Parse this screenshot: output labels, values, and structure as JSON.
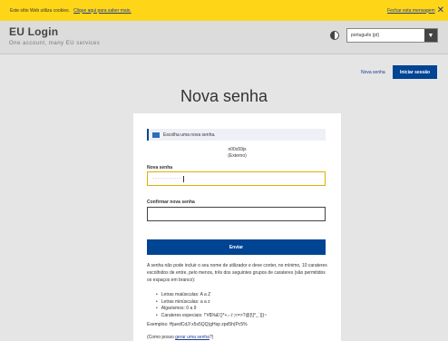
{
  "cookie_bar": {
    "message": "Este sítio Web utiliza cookies.",
    "link": "Clique aqui para saber mais.",
    "close_link": "Fechar esta mensagem",
    "close_icon": "close-icon"
  },
  "header": {
    "logo_title": "EU Login",
    "logo_subtitle": "One account, many EU services",
    "contrast_icon": "contrast-icon",
    "language_selected": "português (pt)",
    "language_arrow": "chevron-down-icon"
  },
  "top_links": {
    "new_password": "Nova senha",
    "login": "Iniciar sessão"
  },
  "main": {
    "title": "Nova senha",
    "info_message": "Escolha uma nova senha.",
    "user_id": "n00s59js",
    "user_type": "(Externo)",
    "password_label": "Nova senha",
    "password_value": "···········",
    "confirm_label": "Confirmar nova senha",
    "confirm_value": "",
    "submit_label": "Enviar",
    "rules_text": "A senha não pode incluir o seu nome de utilizador e deve conter, no mínimo, 10 carateres escolhidos de entre, pelo menos, três dos seguintes grupos de carateres (são permitidos os espaços em branco):",
    "rules": [
      "Letras maiúsculas: A a Z",
      "Letras minúsculas: a a z",
      "Algarismos: 0 a 9",
      "Carateres especiais: !\"#$%&'()*+,-./:;<=>?@[\\]^_`{|}~"
    ],
    "examples": "Exemplos: HjuedCdJl x5s5QQ)gHsp zpd5h(Pc5%",
    "more_prefix": "(Como posso ",
    "more_link": "gerar uma senha",
    "more_suffix": "?)"
  }
}
